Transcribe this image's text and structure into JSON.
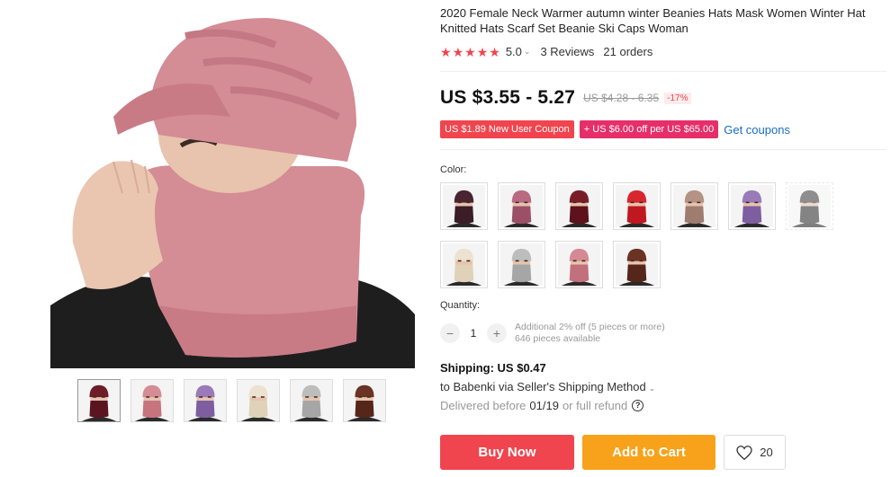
{
  "product": {
    "title": "2020 Female Neck Warmer autumn winter Beanies Hats Mask Women Winter Hat Knitted Hats Scarf Set Beanie Ski Caps Woman"
  },
  "rating": {
    "stars": 5,
    "value": "5.0",
    "reviews": "3 Reviews",
    "orders": "21 orders"
  },
  "price": {
    "current": "US $3.55 - 5.27",
    "original": "US $4.28 - 6.35",
    "discount": "-17%"
  },
  "coupons": {
    "new_user": "US $1.89 New User Coupon",
    "store": "+ US $6.00 off per US $65.00",
    "link": "Get coupons"
  },
  "colors": {
    "label": "Color:",
    "options": [
      {
        "hat": "#4a2430",
        "scarf": "#3a1d26"
      },
      {
        "hat": "#b86a82",
        "scarf": "#9c5068"
      },
      {
        "hat": "#7a1c28",
        "scarf": "#5e121c"
      },
      {
        "hat": "#d9262e",
        "scarf": "#c01820"
      },
      {
        "hat": "#b49284",
        "scarf": "#9e7c70"
      },
      {
        "hat": "#9a7ab8",
        "scarf": "#7e5ea0"
      },
      {
        "hat": "#444444",
        "scarf": "#333333"
      },
      {
        "hat": "#ece2cf",
        "scarf": "#e0d2b8"
      },
      {
        "hat": "#bdbdbd",
        "scarf": "#a6a6a6"
      },
      {
        "hat": "#d58a93",
        "scarf": "#c2707c"
      },
      {
        "hat": "#6a3324",
        "scarf": "#56261a"
      }
    ]
  },
  "thumbnails": [
    {
      "hat": "#6e1c28",
      "scarf": "#5a1520"
    },
    {
      "hat": "#d48c95",
      "scarf": "#c7747f"
    },
    {
      "hat": "#9a7ab8",
      "scarf": "#7e5ea0"
    },
    {
      "hat": "#ece2cf",
      "scarf": "#e0d2b8"
    },
    {
      "hat": "#bdbdbd",
      "scarf": "#a6a6a6"
    },
    {
      "hat": "#6a3324",
      "scarf": "#56261a"
    }
  ],
  "quantity": {
    "label": "Quantity:",
    "value": "1",
    "note_line1": "Additional 2% off (5 pieces or more)",
    "note_line2": "646 pieces available",
    "minus": "−",
    "plus": "+"
  },
  "shipping": {
    "title": "Shipping: US $0.47",
    "method": "to Babenki via Seller's Shipping Method",
    "delivered_prefix": "Delivered before",
    "delivered_date": "01/19",
    "delivered_suffix": "or full refund"
  },
  "actions": {
    "buy_now": "Buy Now",
    "add_to_cart": "Add to Cart",
    "wishlist_count": "20"
  },
  "theme": {
    "accent_red": "#f0454e",
    "coupon_pink": "#e62e6a",
    "cart_orange": "#f7a21a",
    "link_blue": "#1a6cc2",
    "main_hat_color": "#d48c95"
  }
}
